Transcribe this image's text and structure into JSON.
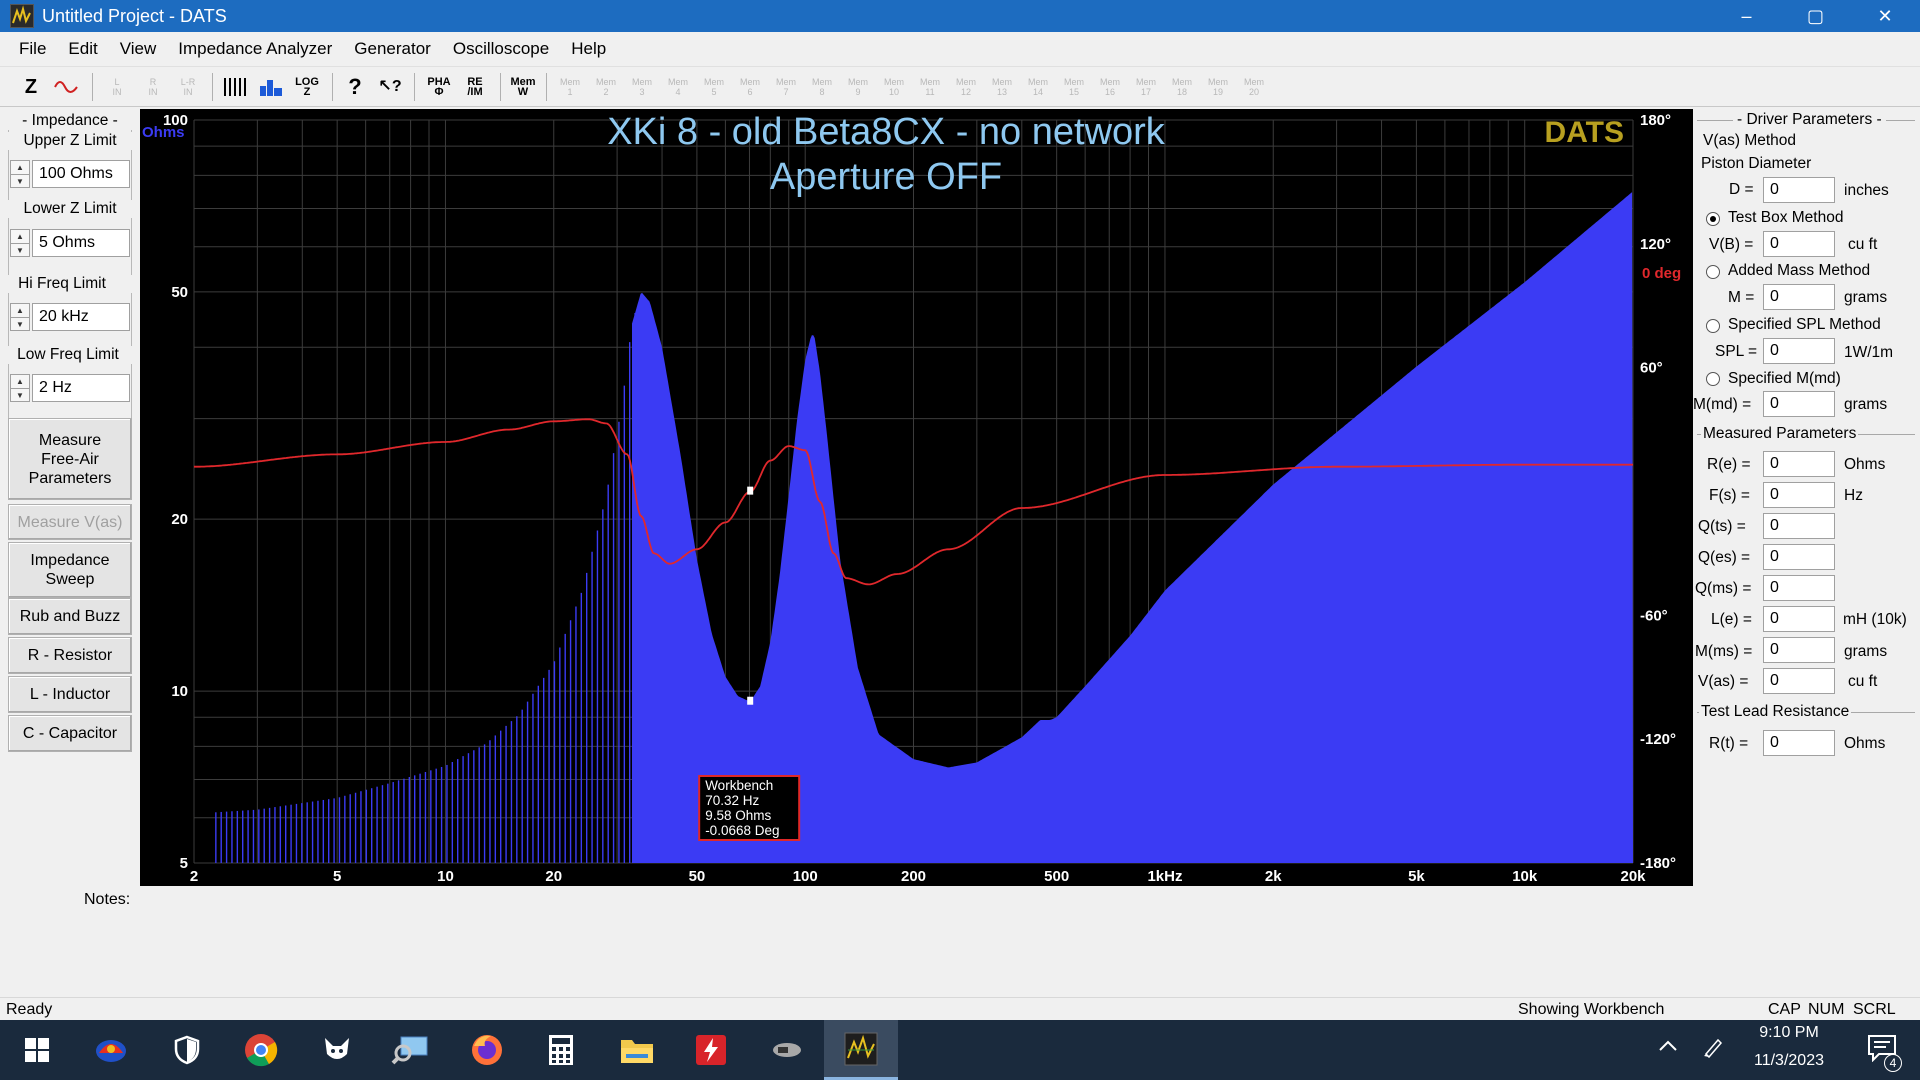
{
  "window": {
    "title": "Untitled Project - DATS",
    "min": "–",
    "max": "▢",
    "close": "✕"
  },
  "menu": [
    "File",
    "Edit",
    "View",
    "Impedance Analyzer",
    "Generator",
    "Oscilloscope",
    "Help"
  ],
  "toolbar": {
    "z": "Z",
    "lin": "L\nIN",
    "rin": "R\nIN",
    "lrin": "L-R\nIN",
    "log": "LOG\nZ",
    "help": "?",
    "context_help": "↖?",
    "pha": "PHA\nΦ",
    "reim": "RE\n/IM",
    "memw": "Mem\nW",
    "mem_slots": [
      "1",
      "2",
      "3",
      "4",
      "5",
      "6",
      "7",
      "8",
      "9",
      "10",
      "11",
      "12",
      "13",
      "14",
      "15",
      "16",
      "17",
      "18",
      "19",
      "20"
    ],
    "mem_label": "Mem"
  },
  "left": {
    "impedance_group": "- Impedance -",
    "upper_label": "Upper Z Limit",
    "upper_val": "100 Ohms",
    "lower_label": "Lower Z Limit",
    "lower_val": "5 Ohms",
    "hi_label": "Hi Freq Limit",
    "hi_val": "20 kHz",
    "low_label": "Low Freq Limit",
    "low_val": "2 Hz",
    "btn_measure_free": "Measure\nFree-Air\nParameters",
    "btn_measure_vas": "Measure V(as)",
    "btn_sweep": "Impedance\nSweep",
    "btn_rub": "Rub and Buzz",
    "btn_r": "R - Resistor",
    "btn_l": "L - Inductor",
    "btn_c": "C - Capacitor"
  },
  "chart_data": {
    "type": "area",
    "title": "XKi 8 - old Beta8CX - no network",
    "subtitle": "Aperture OFF",
    "brand": "DATS",
    "xscale": "log",
    "xlim": [
      2,
      20000
    ],
    "ylim_left": [
      5,
      100
    ],
    "yscale_left": "log",
    "ylabel_left": "Ohms",
    "ylim_right": [
      -180,
      180
    ],
    "ylabel_right": "0 deg",
    "x_ticks": [
      {
        "v": 2,
        "t": "2"
      },
      {
        "v": 5,
        "t": "5"
      },
      {
        "v": 10,
        "t": "10"
      },
      {
        "v": 20,
        "t": "20"
      },
      {
        "v": 50,
        "t": "50"
      },
      {
        "v": 100,
        "t": "100"
      },
      {
        "v": 200,
        "t": "200"
      },
      {
        "v": 500,
        "t": "500"
      },
      {
        "v": 1000,
        "t": "1kHz"
      },
      {
        "v": 2000,
        "t": "2k"
      },
      {
        "v": 5000,
        "t": "5k"
      },
      {
        "v": 10000,
        "t": "10k"
      },
      {
        "v": 20000,
        "t": "20k"
      }
    ],
    "y_ticks_left": [
      {
        "v": 100,
        "t": "100"
      },
      {
        "v": 50,
        "t": "50"
      },
      {
        "v": 20,
        "t": "20"
      },
      {
        "v": 10,
        "t": "10"
      },
      {
        "v": 5,
        "t": "5"
      }
    ],
    "y_ticks_right": [
      {
        "v": 180,
        "t": "180°"
      },
      {
        "v": 120,
        "t": "120°"
      },
      {
        "v": 60,
        "t": "60°"
      },
      {
        "v": -60,
        "t": "-60°"
      },
      {
        "v": -120,
        "t": "-120°"
      },
      {
        "v": -180,
        "t": "-180°"
      }
    ],
    "grid": true,
    "impedance": {
      "name": "Impedance (Ohms)",
      "x": [
        2,
        3,
        5,
        7,
        10,
        13,
        16,
        20,
        24,
        28,
        31,
        33,
        35,
        37,
        40,
        45,
        50,
        55,
        60,
        65,
        70.32,
        75,
        80,
        85,
        90,
        95,
        100,
        104,
        106,
        110,
        115,
        125,
        140,
        160,
        200,
        250,
        300,
        400,
        450,
        480,
        500,
        600,
        800,
        1000,
        2000,
        5000,
        10000,
        20000
      ],
      "y": [
        6.1,
        6.2,
        6.5,
        6.9,
        7.4,
        8.1,
        9.1,
        11.2,
        15,
        22,
        32,
        44,
        50,
        48,
        40,
        26,
        17,
        12.6,
        10.6,
        9.8,
        9.58,
        10.2,
        12.2,
        16,
        22,
        30,
        38,
        42,
        42,
        36,
        28,
        17,
        11,
        8.4,
        7.6,
        7.35,
        7.5,
        8.3,
        8.9,
        8.9,
        9.0,
        10.2,
        12.5,
        15,
        23,
        37,
        52,
        75
      ]
    },
    "phase": {
      "name": "Phase (deg)",
      "x": [
        2,
        5,
        10,
        15,
        20,
        25,
        28,
        32,
        35,
        38,
        42,
        50,
        60,
        70.32,
        80,
        90,
        100,
        110,
        120,
        130,
        150,
        180,
        250,
        400,
        1000,
        3000,
        10000,
        20000
      ],
      "y": [
        12,
        18,
        24,
        30,
        34,
        35,
        33,
        18,
        -12,
        -30,
        -35,
        -28,
        -15,
        -0.0668,
        15,
        22,
        20,
        -5,
        -30,
        -42,
        -45,
        -40,
        -28,
        -8,
        8,
        12,
        13,
        13
      ]
    },
    "cursor": {
      "label": "Workbench",
      "freq": "70.32 Hz",
      "ohms": "9.58 Ohms",
      "deg": "-0.0668 Deg",
      "x": 70.32,
      "y_ohms": 9.58,
      "y_deg": -0.0668
    },
    "colors": {
      "impedance": "#3b3bf4",
      "phase": "#e0282c",
      "title": "#8ec8f0",
      "brand": "#b8a020",
      "grid": "#3c3c3c",
      "cursor_border": "#e02828"
    }
  },
  "right": {
    "driver_group": "- Driver Parameters -",
    "vas_method": "V(as) Method",
    "piston": "Piston Diameter",
    "d_label": "D =",
    "d_val": "0",
    "d_unit": "inches",
    "test_box": "Test Box Method",
    "vb_label": "V(B) =",
    "vb_val": "0",
    "vb_unit": "cu ft",
    "added_mass": "Added Mass Method",
    "m_label": "M =",
    "m_val": "0",
    "m_unit": "grams",
    "spl_method": "Specified SPL Method",
    "spl_label": "SPL =",
    "spl_val": "0",
    "spl_unit": "1W/1m",
    "mmd_method": "Specified M(md)",
    "mmd_label": "M(md) =",
    "mmd_val": "0",
    "mmd_unit": "grams",
    "measured_group": "Measured Parameters",
    "re_label": "R(e) =",
    "re_val": "0",
    "re_unit": "Ohms",
    "fs_label": "F(s) =",
    "fs_val": "0",
    "fs_unit": "Hz",
    "qts_label": "Q(ts) =",
    "qts_val": "0",
    "qes_label": "Q(es) =",
    "qes_val": "0",
    "qms_label": "Q(ms) =",
    "qms_val": "0",
    "le_label": "L(e) =",
    "le_val": "0",
    "le_unit": "mH (10k)",
    "mms_label": "M(ms) =",
    "mms_val": "0",
    "mms_unit": "grams",
    "vas_label": "V(as) =",
    "vas_val": "0",
    "vas_unit": "cu ft",
    "lead_group": "Test Lead Resistance",
    "rt_label": "R(t) =",
    "rt_val": "0",
    "rt_unit": "Ohms"
  },
  "notes_label": "Notes:",
  "status": {
    "ready": "Ready",
    "showing": "Showing Workbench",
    "cap": "CAP",
    "num": "NUM",
    "scrl": "SCRL"
  },
  "taskbar": {
    "time": "9:10 PM",
    "date": "11/3/2023",
    "notif_count": "4"
  }
}
